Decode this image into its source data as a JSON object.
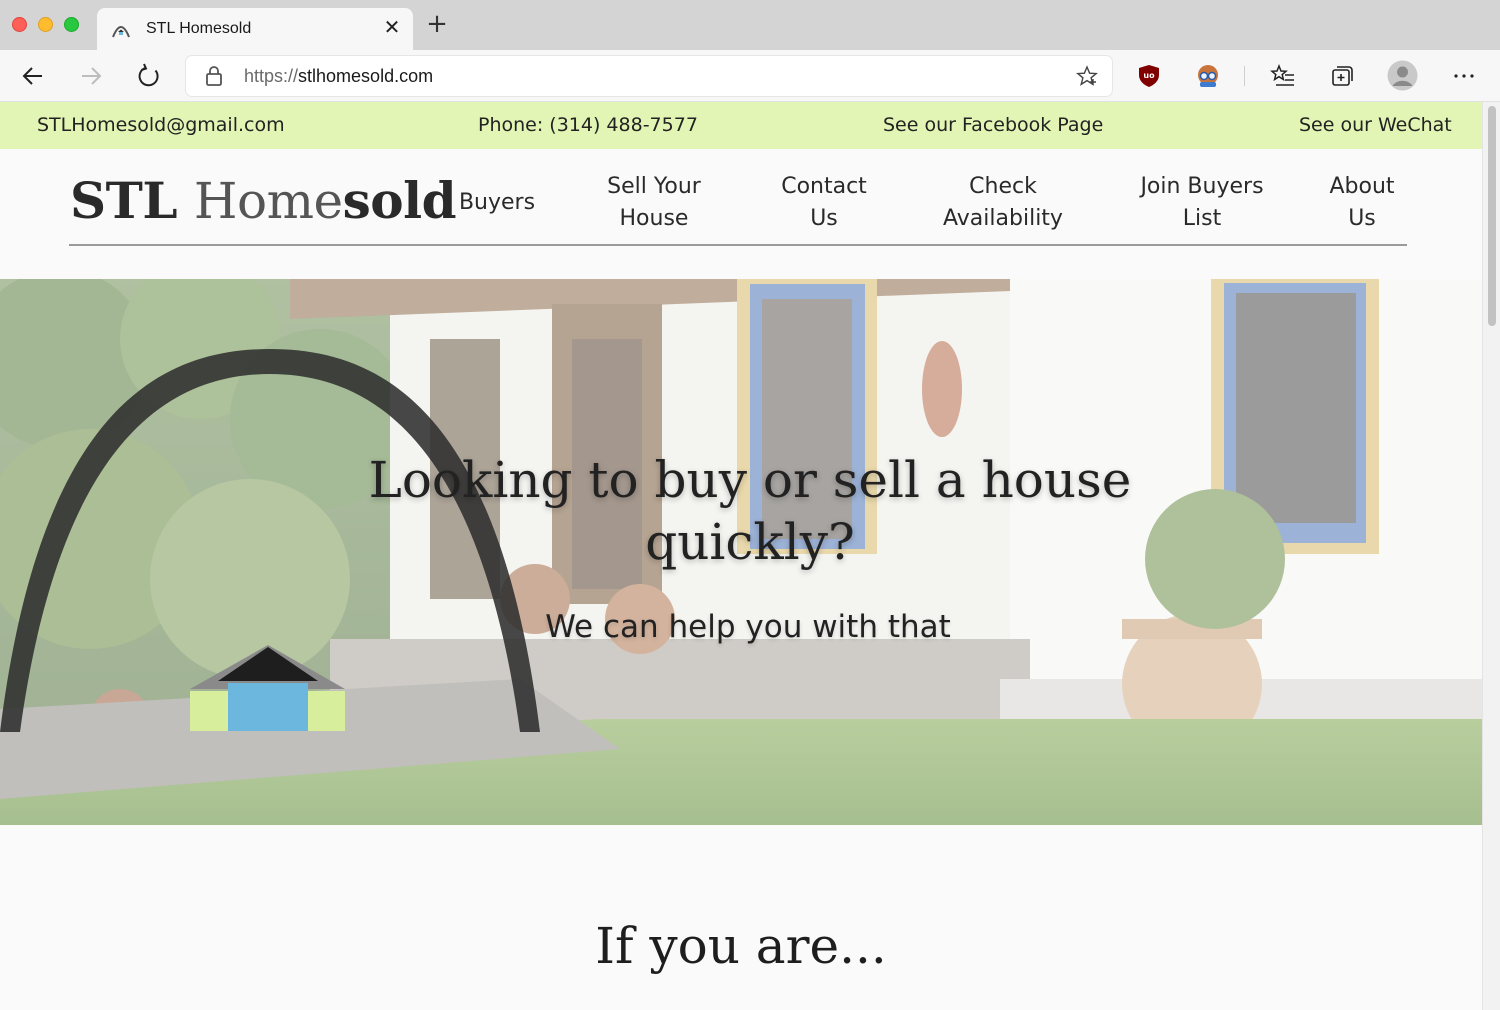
{
  "browser": {
    "tab_title": "STL Homesold",
    "url_protocol": "https://",
    "url_host": "stlhomesold.com"
  },
  "topbar": {
    "email": "STLHomesold@gmail.com",
    "phone": "Phone: (314) 488-7577",
    "facebook": "See our Facebook Page",
    "wechat": "See our WeChat"
  },
  "logo": {
    "part1": "STL ",
    "part2": "Home",
    "part3": "sold"
  },
  "nav": [
    "Buyers",
    "Sell Your\nHouse",
    "Contact\nUs",
    "Check\nAvailability",
    "Join Buyers\nList",
    "About\nUs"
  ],
  "hero": {
    "title": "Looking to buy or sell a house quickly?",
    "subtitle": "We can help you with that"
  },
  "section": {
    "title": "If you are..."
  },
  "colors": {
    "topbar_bg": "#e2f5b4",
    "arch": "#2f2f2f",
    "logo_blue": "#6bb7dd",
    "logo_green": "#d7ef9c"
  }
}
